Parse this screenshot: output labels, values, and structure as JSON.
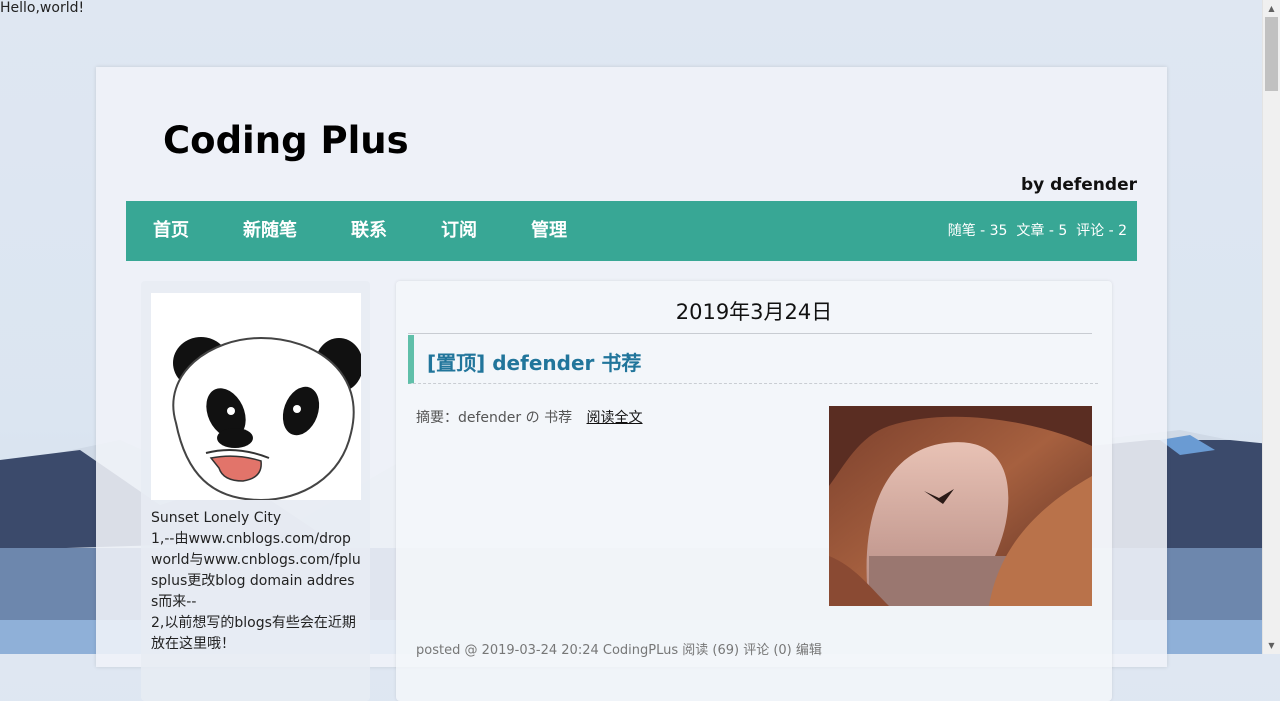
{
  "hello_text": "Hello,world!",
  "blog": {
    "title": "Coding Plus",
    "subtitle": "by defender"
  },
  "nav": {
    "items": [
      "首页",
      "新随笔",
      "联系",
      "订阅",
      "管理"
    ],
    "stats": "随笔 - 35  文章 - 5  评论 - 2"
  },
  "sidebar": {
    "lines": [
      "Sunset Lonely City",
      "1,--由www.cnblogs.com/dropworld与www.cnblogs.com/fplusplus更改blog domain address而来--",
      "2,以前想写的blogs有些会在近期放在这里哦！"
    ]
  },
  "post": {
    "date": "2019年3月24日",
    "title": "[置顶] defender 书荐",
    "summary": "摘要：defender の 书荐",
    "read_more": "阅读全文",
    "footer": "posted @ 2019-03-24 20:24 CodingPLus 阅读 (69) 评论 (0) 编辑"
  },
  "colors": {
    "nav_bg": "#38a795",
    "title_link": "#21759b",
    "accent_bar": "#5fbfa9"
  },
  "icons": {
    "scroll_up": "scroll-up-arrow-icon",
    "scroll_down": "scroll-down-arrow-icon"
  }
}
